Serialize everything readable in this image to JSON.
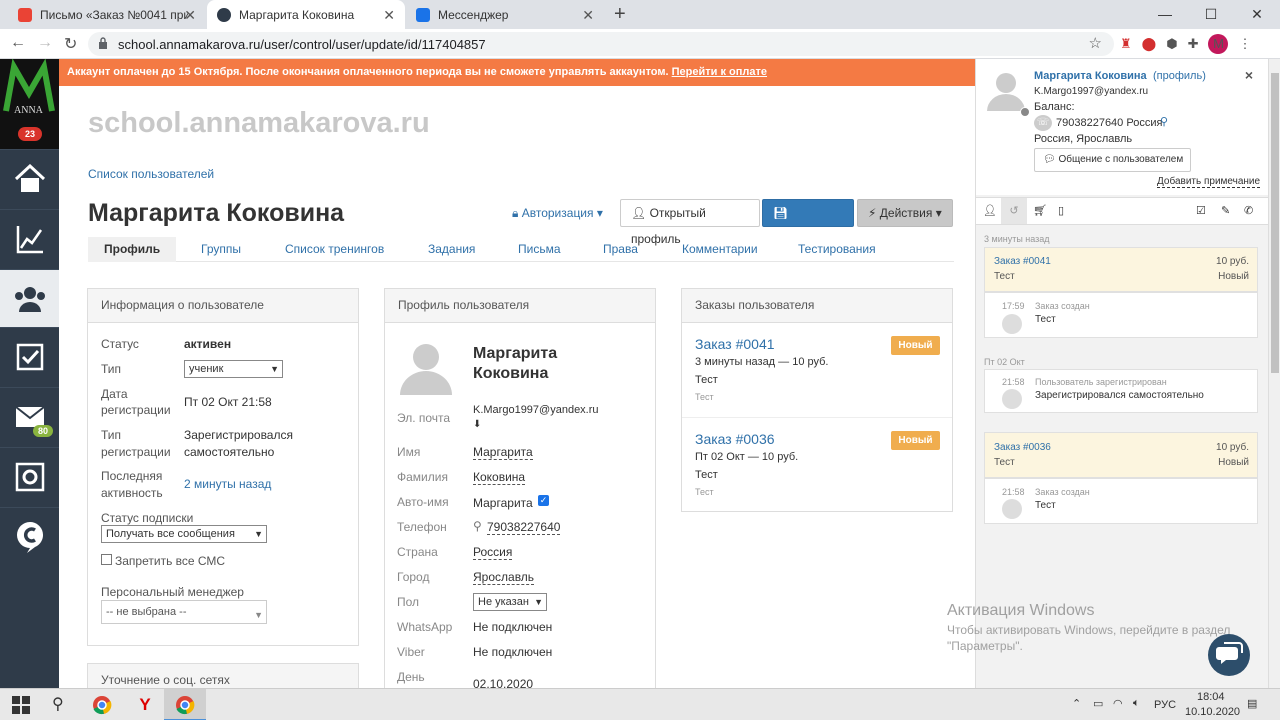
{
  "browser": {
    "tabs": [
      {
        "title": "Письмо «Заказ №0041 принят»",
        "active": false
      },
      {
        "title": "Маргарита Коковина",
        "active": true
      },
      {
        "title": "Мессенджер",
        "active": false
      }
    ],
    "url": "school.annamakarova.ru/user/control/user/update/id/117404857",
    "profile_initial": "M"
  },
  "sidebar": {
    "logo_text": "ANNA",
    "logo_badge": "23",
    "mail_badge": "80"
  },
  "banner": {
    "text": "Аккаунт оплачен до 15 Октября. После окончания оплаченного периода вы не сможете управлять аккаунтом. ",
    "link": "Перейти к оплате"
  },
  "page": {
    "site_title": "school.annamakarova.ru",
    "breadcrumb": "Список пользователей",
    "user_name": "Маргарита Коковина",
    "auth_label": "Авторизация",
    "btn_open_profile": "Открытый профиль",
    "btn_save": "Сохранить",
    "btn_actions": "Действия",
    "tabs": [
      "Профиль",
      "Группы",
      "Список тренингов",
      "Задания",
      "Письма",
      "Права",
      "Комментарии",
      "Тестирования"
    ]
  },
  "info_panel": {
    "title": "Информация о пользователе",
    "status_label": "Статус",
    "status_value": "активен",
    "type_label": "Тип",
    "type_value": "ученик",
    "reg_date_label1": "Дата",
    "reg_date_label2": "регистрации",
    "reg_date_value": "Пт 02 Окт 21:58",
    "reg_type_label1": "Тип",
    "reg_type_label2": "регистрации",
    "reg_type_value1": "Зарегистрировался",
    "reg_type_value2": "самостоятельно",
    "last_label1": "Последняя",
    "last_label2": "активность",
    "last_value": "2 минуты назад",
    "sub_label": "Статус подписки",
    "sub_value": "Получать все сообщения",
    "sms_label": "Запретить все СМС",
    "manager_label": "Персональный менеджер",
    "manager_value": "-- не выбрана --",
    "social_title": "Уточнение о соц. сетях"
  },
  "profile_panel": {
    "title": "Профиль пользователя",
    "name_line1": "Маргарита",
    "name_line2": "Коковина",
    "email_label": "Эл. почта",
    "email_value": "K.Margo1997@yandex.ru",
    "firstname_label": "Имя",
    "firstname_value": "Маргарита",
    "lastname_label": "Фамилия",
    "lastname_value": "Коковина",
    "autoname_label": "Авто-имя",
    "autoname_value": "Маргарита",
    "phone_label": "Телефон",
    "phone_value": "79038227640",
    "country_label": "Страна",
    "country_value": "Россия",
    "city_label": "Город",
    "city_value": "Ярославль",
    "gender_label": "Пол",
    "gender_value": "Не указан",
    "whatsapp_label": "WhatsApp",
    "whatsapp_value": "Не подключен",
    "viber_label": "Viber",
    "viber_value": "Не подключен",
    "day_label": "День",
    "day_value": "02.10.2020"
  },
  "orders_panel": {
    "title": "Заказы пользователя",
    "orders": [
      {
        "title": "Заказ #0041",
        "meta": "3 минуты назад — 10 руб.",
        "name": "Тест",
        "sub": "Тест",
        "badge": "Новый"
      },
      {
        "title": "Заказ #0036",
        "meta": "Пт 02 Окт — 10 руб.",
        "name": "Тест",
        "sub": "Тест",
        "badge": "Новый"
      }
    ]
  },
  "right_panel": {
    "user_name": "Маргарита Коковина",
    "profile_link": "(профиль)",
    "email": "K.Margo1997@yandex.ru",
    "balance_label": "Баланс:",
    "phone": "79038227640 Россия",
    "location": "Россия, Ярославль",
    "chat_button": "Общение с пользователем",
    "add_note": "Добавить примечание",
    "close": "×",
    "group1_time": "3 минуты назад",
    "order1_title": "Заказ #0041",
    "order1_sub": "Тест",
    "order1_price": "10 руб.",
    "order1_status": "Новый",
    "event1_time": "17:59",
    "event1_title": "Заказ создан",
    "event1_text": "Тест",
    "group2_time": "Пт 02 Окт",
    "event2_time": "21:58",
    "event2_title": "Пользователь зарегистрирован",
    "event2_text": "Зарегистрировался самостоятельно",
    "order2_title": "Заказ #0036",
    "order2_sub": "Тест",
    "order2_price": "10 руб.",
    "order2_status": "Новый",
    "event3_time": "21:58",
    "event3_title": "Заказ создан",
    "event3_text": "Тест"
  },
  "watermark": {
    "line1": "Активация Windows",
    "line2": "Чтобы активировать Windows, перейдите в раздел",
    "line3": "\"Параметры\"."
  },
  "taskbar": {
    "lang": "РУС",
    "time": "18:04",
    "date": "10.10.2020"
  },
  "colors": {
    "banner": "#f47a44",
    "link": "#3071a9",
    "primary": "#337ab7",
    "badge_new": "#f0ad4e",
    "sidebar": "#2f3b49"
  }
}
